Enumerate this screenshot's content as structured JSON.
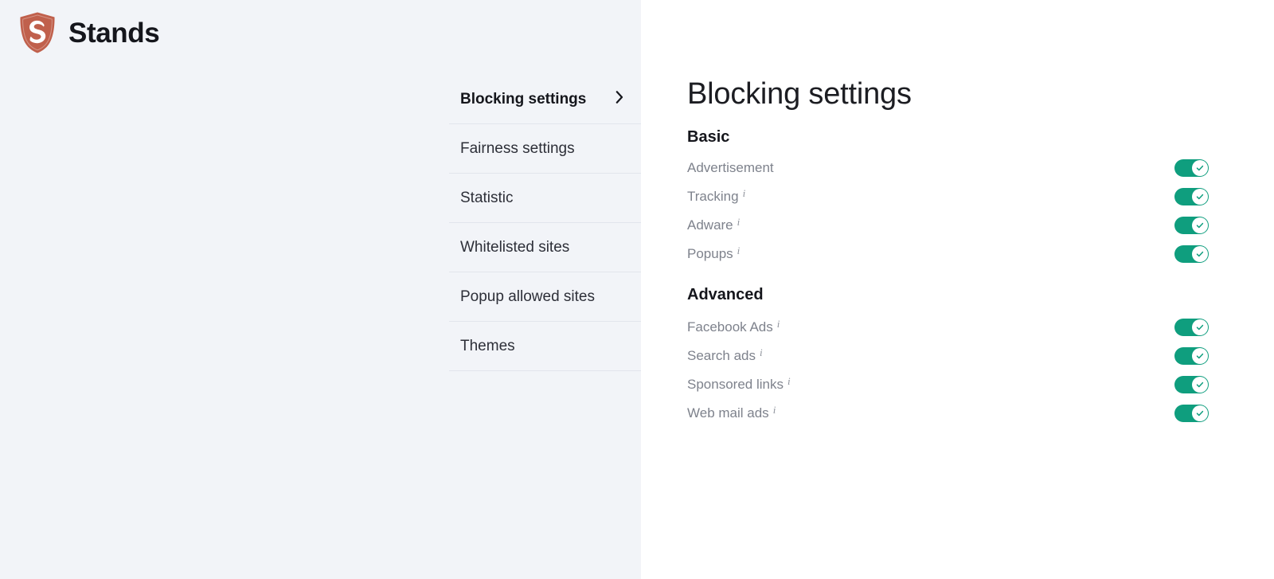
{
  "brand": {
    "name": "Stands",
    "logo_icon": "shield-s-logo",
    "logo_color": "#c0604c"
  },
  "sidebar": {
    "items": [
      {
        "label": "Blocking settings",
        "active": true,
        "chevron": "chevron-right-icon"
      },
      {
        "label": "Fairness settings",
        "active": false
      },
      {
        "label": "Statistic",
        "active": false
      },
      {
        "label": "Whitelisted sites",
        "active": false
      },
      {
        "label": "Popup allowed sites",
        "active": false
      },
      {
        "label": "Themes",
        "active": false
      }
    ]
  },
  "main": {
    "title": "Blocking settings",
    "groups": [
      {
        "title": "Basic",
        "settings": [
          {
            "label": "Advertisement",
            "info": false,
            "enabled": true
          },
          {
            "label": "Tracking",
            "info": true,
            "info_icon": "info-icon",
            "enabled": true
          },
          {
            "label": "Adware",
            "info": true,
            "info_icon": "info-icon",
            "enabled": true
          },
          {
            "label": "Popups",
            "info": true,
            "info_icon": "info-icon",
            "enabled": true
          }
        ]
      },
      {
        "title": "Advanced",
        "settings": [
          {
            "label": "Facebook Ads",
            "info": true,
            "info_icon": "info-icon",
            "enabled": true
          },
          {
            "label": "Search ads",
            "info": true,
            "info_icon": "info-icon",
            "enabled": true
          },
          {
            "label": "Sponsored links",
            "info": true,
            "info_icon": "info-icon",
            "enabled": true
          },
          {
            "label": "Web mail ads",
            "info": true,
            "info_icon": "info-icon",
            "enabled": true
          }
        ]
      }
    ]
  },
  "colors": {
    "toggle_on": "#0f9e7e",
    "panel_background": "#f2f4f8",
    "content_background": "#ffffff",
    "label_text": "#7e828c",
    "heading_text": "#15161c",
    "divider": "#e2e5ec"
  },
  "info_symbol": "i"
}
